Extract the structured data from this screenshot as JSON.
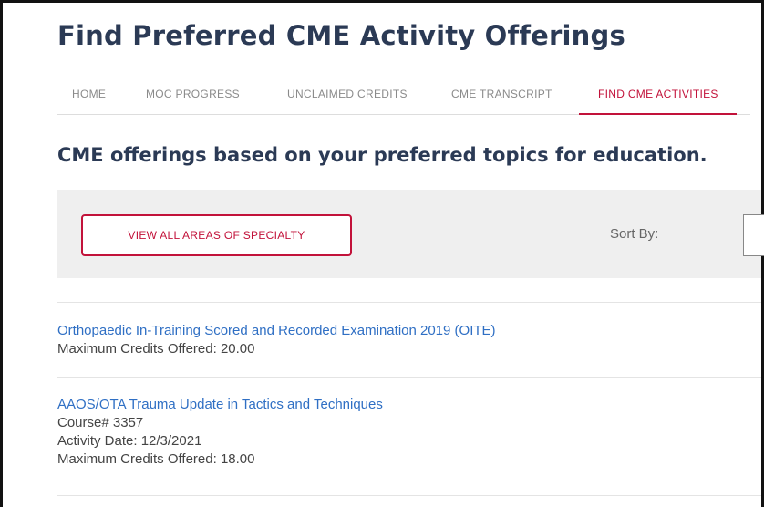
{
  "page": {
    "title": "Find Preferred CME Activity Offerings",
    "subtitle": "CME offerings based on your preferred topics for education."
  },
  "nav": {
    "tabs": [
      {
        "label": "HOME",
        "active": false
      },
      {
        "label": "MOC PROGRESS",
        "active": false
      },
      {
        "label": "UNCLAIMED CREDITS",
        "active": false
      },
      {
        "label": "CME TRANSCRIPT",
        "active": false
      },
      {
        "label": "FIND CME ACTIVITIES",
        "active": true
      }
    ]
  },
  "toolbar": {
    "specialty_button": "VIEW ALL AREAS OF SPECIALTY",
    "sort_label": "Sort By:"
  },
  "activities": [
    {
      "title": "Orthopaedic In-Training Scored and Recorded Examination 2019 (OITE)",
      "credits": "Maximum Credits Offered: 20.00"
    },
    {
      "title": "AAOS/OTA Trauma Update in Tactics and Techniques",
      "course": "Course# 3357",
      "date": "Activity Date: 12/3/2021",
      "credits": "Maximum Credits Offered: 18.00"
    }
  ],
  "colors": {
    "accent": "#c2123a",
    "heading": "#2b3a55",
    "link": "#2f6fc4",
    "toolbar_bg": "#efefef"
  }
}
